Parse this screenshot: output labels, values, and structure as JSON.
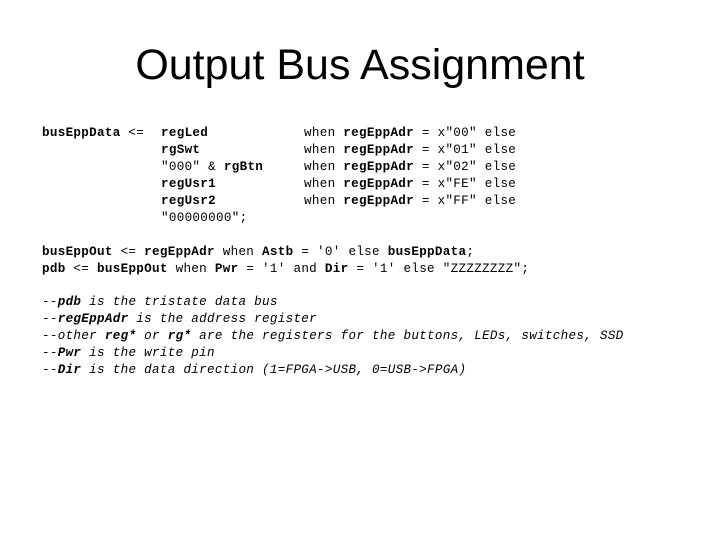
{
  "slide": {
    "title": "Output Bus Assignment"
  },
  "mux": {
    "lhs": [
      [
        {
          "t": "busEppData",
          "b": true
        },
        {
          "t": " <= ",
          "b": false
        }
      ]
    ],
    "values": [
      [
        {
          "t": "regLed",
          "b": true
        }
      ],
      [
        {
          "t": "rgSwt",
          "b": true
        }
      ],
      [
        {
          "t": "\"000\" & ",
          "b": false
        },
        {
          "t": "rgBtn",
          "b": true
        }
      ],
      [
        {
          "t": "regUsr1",
          "b": true
        }
      ],
      [
        {
          "t": "regUsr2",
          "b": true
        }
      ],
      [
        {
          "t": "\"00000000\";",
          "b": false
        }
      ]
    ],
    "conditions": [
      [
        {
          "t": "when ",
          "b": false
        },
        {
          "t": "regEppAdr",
          "b": true
        },
        {
          "t": " = x\"00\" else",
          "b": false
        }
      ],
      [
        {
          "t": "when ",
          "b": false
        },
        {
          "t": "regEppAdr",
          "b": true
        },
        {
          "t": " = x\"01\" else",
          "b": false
        }
      ],
      [
        {
          "t": "when ",
          "b": false
        },
        {
          "t": "regEppAdr",
          "b": true
        },
        {
          "t": " = x\"02\" else",
          "b": false
        }
      ],
      [
        {
          "t": "when ",
          "b": false
        },
        {
          "t": "regEppAdr",
          "b": true
        },
        {
          "t": " = x\"FE\" else",
          "b": false
        }
      ],
      [
        {
          "t": "when ",
          "b": false
        },
        {
          "t": "regEppAdr",
          "b": true
        },
        {
          "t": " = x\"FF\" else",
          "b": false
        }
      ]
    ]
  },
  "assignments": [
    [
      {
        "t": "busEppOut",
        "b": true
      },
      {
        "t": " <= ",
        "b": false
      },
      {
        "t": "regEppAdr",
        "b": true
      },
      {
        "t": " when ",
        "b": false
      },
      {
        "t": "Astb",
        "b": true
      },
      {
        "t": " = '0' else ",
        "b": false
      },
      {
        "t": "busEppData",
        "b": true
      },
      {
        "t": ";",
        "b": false
      }
    ],
    [
      {
        "t": "pdb",
        "b": true
      },
      {
        "t": " <= ",
        "b": false
      },
      {
        "t": "busEppOut",
        "b": true
      },
      {
        "t": " when ",
        "b": false
      },
      {
        "t": "Pwr",
        "b": true
      },
      {
        "t": " = '1' and ",
        "b": false
      },
      {
        "t": "Dir",
        "b": true
      },
      {
        "t": " = '1' else \"ZZZZZZZZ\";",
        "b": false
      }
    ]
  ],
  "comments": [
    [
      {
        "t": "--",
        "b": false
      },
      {
        "t": "pdb",
        "b": true
      },
      {
        "t": " is the tristate data bus",
        "b": false
      }
    ],
    [
      {
        "t": "--",
        "b": false
      },
      {
        "t": "regEppAdr",
        "b": true
      },
      {
        "t": " is the address register",
        "b": false
      }
    ],
    [
      {
        "t": "--other ",
        "b": false
      },
      {
        "t": "reg*",
        "b": true
      },
      {
        "t": " or ",
        "b": false
      },
      {
        "t": "rg*",
        "b": true
      },
      {
        "t": " are the registers for the buttons, LEDs, switches, SSD",
        "b": false
      }
    ],
    [
      {
        "t": "--",
        "b": false
      },
      {
        "t": "Pwr",
        "b": true
      },
      {
        "t": " is the write pin",
        "b": false
      }
    ],
    [
      {
        "t": "--",
        "b": false
      },
      {
        "t": "Dir",
        "b": true
      },
      {
        "t": " is the data direction (1=FPGA->USB, 0=USB->FPGA)",
        "b": false
      }
    ]
  ]
}
